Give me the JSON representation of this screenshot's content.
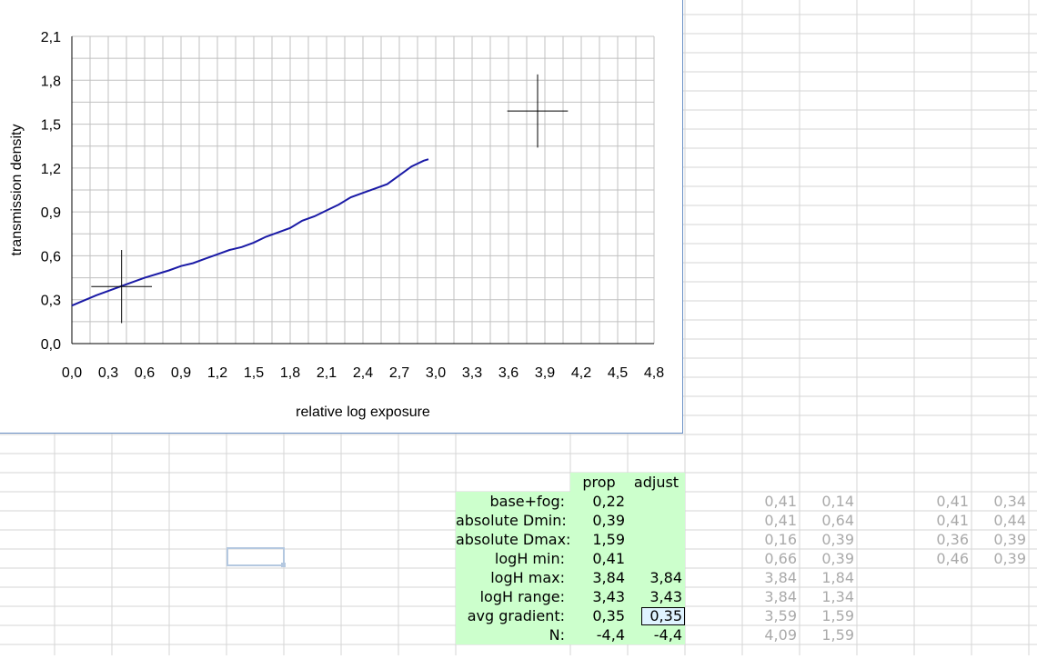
{
  "chart_data": {
    "type": "line",
    "xlabel": "relative log exposure",
    "ylabel": "transmission density",
    "xlim": [
      0,
      4.8
    ],
    "ylim": [
      0,
      2.1
    ],
    "x_ticks": [
      "0,0",
      "0,3",
      "0,6",
      "0,9",
      "1,2",
      "1,5",
      "1,8",
      "2,1",
      "2,4",
      "2,7",
      "3,0",
      "3,3",
      "3,6",
      "3,9",
      "4,2",
      "4,5",
      "4,8"
    ],
    "y_ticks": [
      "0,0",
      "0,3",
      "0,6",
      "0,9",
      "1,2",
      "1,5",
      "1,8",
      "2,1"
    ],
    "grid": true,
    "legend": "none",
    "series": [
      {
        "color": "#1a1aa6",
        "x": [
          0,
          0.2,
          0.4,
          0.6,
          0.8,
          0.9,
          1.0,
          1.1,
          1.2,
          1.3,
          1.4,
          1.5,
          1.6,
          1.7,
          1.8,
          1.9,
          2.0,
          2.1,
          2.2,
          2.3,
          2.4,
          2.5,
          2.6,
          2.7,
          2.8,
          2.9,
          2.94
        ],
        "y": [
          0.26,
          0.33,
          0.39,
          0.45,
          0.5,
          0.53,
          0.55,
          0.58,
          0.61,
          0.64,
          0.66,
          0.69,
          0.73,
          0.76,
          0.79,
          0.84,
          0.87,
          0.91,
          0.95,
          1.0,
          1.03,
          1.06,
          1.09,
          1.15,
          1.21,
          1.25,
          1.26
        ]
      }
    ],
    "markers": [
      {
        "x": 0.41,
        "y": 0.39,
        "dx": 0.25,
        "dy": 0.25
      },
      {
        "x": 3.84,
        "y": 1.59,
        "dx": 0.25,
        "dy": 0.25
      }
    ]
  },
  "table": {
    "col_headers": [
      "prop",
      "adjust"
    ],
    "rows": [
      {
        "label": "base+fog:",
        "prop": "0,22",
        "adjust": ""
      },
      {
        "label": "absolute Dmin:",
        "prop": "0,39",
        "adjust": ""
      },
      {
        "label": "absolute Dmax:",
        "prop": "1,59",
        "adjust": ""
      },
      {
        "label": "logH min:",
        "prop": "0,41",
        "adjust": ""
      },
      {
        "label": "logH max:",
        "prop": "3,84",
        "adjust": "3,84"
      },
      {
        "label": "logH range:",
        "prop": "3,43",
        "adjust": "3,43"
      },
      {
        "label": "avg gradient:",
        "prop": "0,35",
        "adjust": "0,35"
      },
      {
        "label": "N:",
        "prop": "-4,4",
        "adjust": "-4,4"
      }
    ]
  },
  "aux_block_1": [
    [
      "0,41",
      "0,14"
    ],
    [
      "0,41",
      "0,64"
    ],
    [
      "0,16",
      "0,39"
    ],
    [
      "0,66",
      "0,39"
    ],
    [
      "3,84",
      "1,84"
    ],
    [
      "3,84",
      "1,34"
    ],
    [
      "3,59",
      "1,59"
    ],
    [
      "4,09",
      "1,59"
    ]
  ],
  "aux_block_2": [
    [
      "0,41",
      "0,34"
    ],
    [
      "0,41",
      "0,44"
    ],
    [
      "0,36",
      "0,39"
    ],
    [
      "0,46",
      "0,39"
    ]
  ],
  "colors": {
    "table_fill": "#ccffcc",
    "series_line": "#1a1aa6",
    "grid": "#c0c0c0",
    "faded_text": "#aaaaaa",
    "active_cell_fill": "#dff3ff"
  }
}
